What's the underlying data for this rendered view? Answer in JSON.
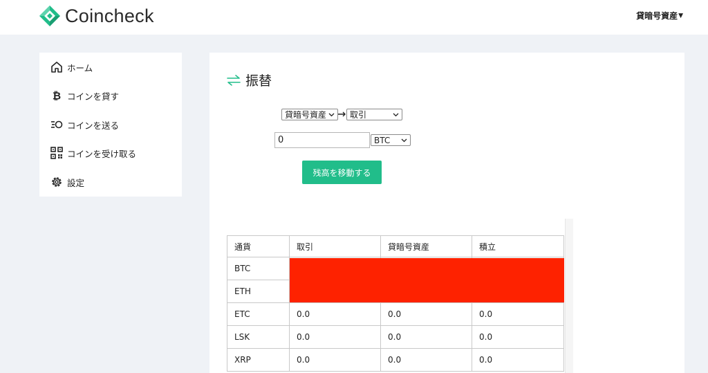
{
  "header": {
    "logo_text": "Coincheck",
    "account_menu_label": "貸暗号資産",
    "brand_color": "#21bd8a"
  },
  "sidebar": {
    "items": [
      {
        "label": "ホーム",
        "icon": "home-icon"
      },
      {
        "label": "コインを貸す",
        "icon": "bitcoin-icon"
      },
      {
        "label": "コインを送る",
        "icon": "send-icon"
      },
      {
        "label": "コインを受け取る",
        "icon": "qr-code-icon"
      },
      {
        "label": "設定",
        "icon": "gear-icon"
      }
    ]
  },
  "main": {
    "title": "振替",
    "title_icon": "transfer-arrows-icon",
    "transfer": {
      "from_selected": "貸暗号資産",
      "to_selected": "取引",
      "amount_value": "0",
      "currency_selected": "BTC",
      "submit_label": "残高を移動する"
    },
    "table": {
      "headers": [
        "通貨",
        "取引",
        "貸暗号資産",
        "積立"
      ],
      "rows": [
        [
          "BTC",
          "",
          "",
          ""
        ],
        [
          "ETH",
          "",
          "",
          ""
        ],
        [
          "ETC",
          "0.0",
          "0.0",
          "0.0"
        ],
        [
          "LSK",
          "0.0",
          "0.0",
          "0.0"
        ],
        [
          "XRP",
          "0.0",
          "0.0",
          "0.0"
        ]
      ],
      "redaction_color": "#fe2200"
    }
  }
}
